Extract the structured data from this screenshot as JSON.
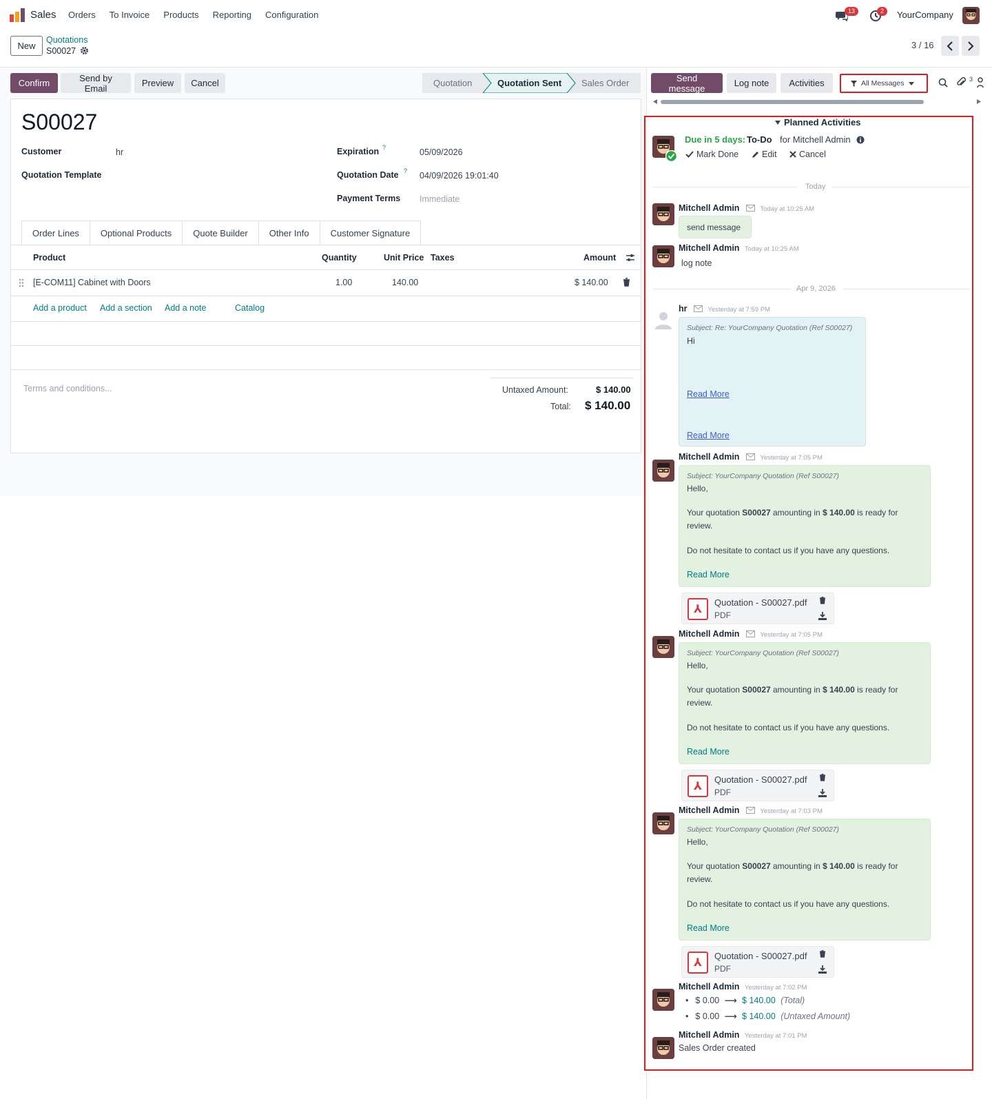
{
  "nav": {
    "app": "Sales",
    "menu": [
      "Orders",
      "To Invoice",
      "Products",
      "Reporting",
      "Configuration"
    ],
    "chat_count": "13",
    "activity_count": "2",
    "company": "YourCompany"
  },
  "control": {
    "new_label": "New",
    "breadcrumb_parent": "Quotations",
    "breadcrumb_current": "S00027",
    "pager": "3 / 16"
  },
  "actions": {
    "confirm": "Confirm",
    "send_email": "Send by Email",
    "preview": "Preview",
    "cancel": "Cancel"
  },
  "statusbar": [
    "Quotation",
    "Quotation Sent",
    "Sales Order"
  ],
  "status_active": "Quotation Sent",
  "chatter_buttons": {
    "send_message": "Send message",
    "log_note": "Log note",
    "activities": "Activities",
    "filter": "All Messages",
    "attachment_count": "3"
  },
  "form": {
    "title": "S00027",
    "customer_label": "Customer",
    "customer_value": "hr",
    "template_label": "Quotation Template",
    "expiration_label": "Expiration",
    "expiration_value": "05/09/2026",
    "quotation_date_label": "Quotation Date",
    "quotation_date_value": "04/09/2026 19:01:40",
    "payment_terms_label": "Payment Terms",
    "payment_terms_placeholder": "Immediate",
    "help_mark": "?"
  },
  "tabs": [
    "Order Lines",
    "Optional Products",
    "Quote Builder",
    "Other Info",
    "Customer Signature"
  ],
  "lines": {
    "headers": {
      "product": "Product",
      "quantity": "Quantity",
      "unit_price": "Unit Price",
      "taxes": "Taxes",
      "amount": "Amount"
    },
    "rows": [
      {
        "product": "[E-COM11] Cabinet with Doors",
        "quantity": "1.00",
        "unit_price": "140.00",
        "taxes": "",
        "amount": "$ 140.00"
      }
    ],
    "add_product": "Add a product",
    "add_section": "Add a section",
    "add_note": "Add a note",
    "catalog": "Catalog"
  },
  "totals": {
    "terms_placeholder": "Terms and conditions...",
    "untaxed_label": "Untaxed Amount:",
    "untaxed_value": "$ 140.00",
    "total_label": "Total:",
    "total_value": "$ 140.00"
  },
  "chatter": {
    "planned_title": "Planned Activities",
    "activity": {
      "due": "Due in 5 days:",
      "type": "To-Do",
      "for": "for Mitchell Admin",
      "mark_done": "Mark Done",
      "edit": "Edit",
      "cancel": "Cancel"
    },
    "sep_today": "Today",
    "sep_apr": "Apr 9, 2026",
    "msg1": {
      "author": "Mitchell Admin",
      "time": "Today at 10:25 AM",
      "body": "send message"
    },
    "msg2": {
      "author": "Mitchell Admin",
      "time": "Today at 10:25 AM",
      "body": "log note"
    },
    "msg3": {
      "author": "hr",
      "time": "Yesterday at 7:59 PM",
      "subject": "Subject: Re: YourCompany Quotation (Ref S00027)",
      "body": "Hi",
      "read_more1": "Read More",
      "read_more2": "Read More"
    },
    "email_msgs": [
      {
        "author": "Mitchell Admin",
        "time": "Yesterday at 7:05 PM"
      },
      {
        "author": "Mitchell Admin",
        "time": "Yesterday at 7:05 PM"
      },
      {
        "author": "Mitchell Admin",
        "time": "Yesterday at 7:03 PM"
      }
    ],
    "email": {
      "subject": "Subject: YourCompany Quotation (Ref S00027)",
      "hello": "Hello,",
      "p1_a": "Your quotation ",
      "p1_ref": "S00027",
      "p1_b": " amounting in ",
      "p1_amt": "$ 140.00",
      "p1_c": " is ready for review.",
      "p2": "Do not hesitate to contact us if you have any questions.",
      "read_more": "Read More",
      "attachment_name": "Quotation - S00027.pdf",
      "attachment_type": "PDF"
    },
    "tracking": {
      "author": "Mitchell Admin",
      "time": "Yesterday at 7:02 PM",
      "items": [
        {
          "old": "$ 0.00",
          "new": "$ 140.00",
          "field": "(Total)"
        },
        {
          "old": "$ 0.00",
          "new": "$ 140.00",
          "field": "(Untaxed Amount)"
        }
      ]
    },
    "created": {
      "author": "Mitchell Admin",
      "time": "Yesterday at 7:01 PM",
      "body": "Sales Order created"
    }
  }
}
